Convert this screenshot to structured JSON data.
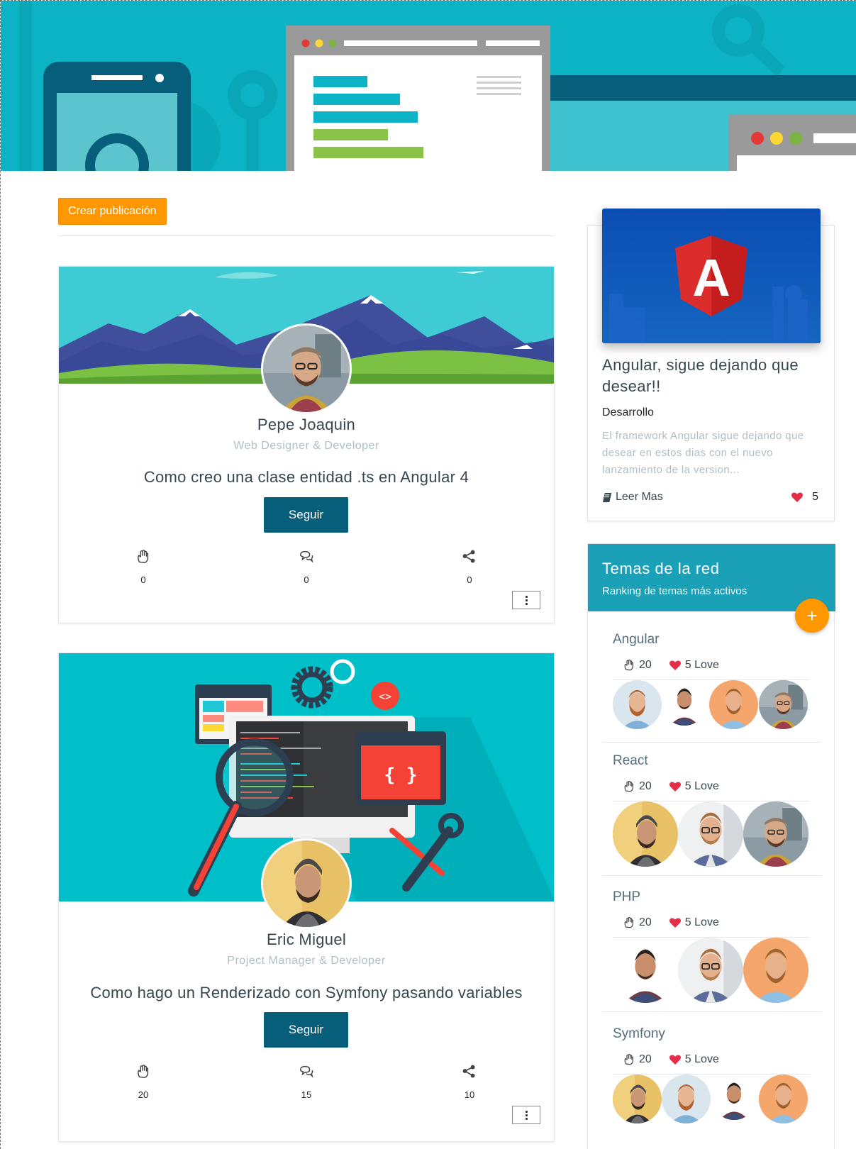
{
  "colors": {
    "hero_bg": "#0bb3c4",
    "accent_orange": "#ff9800",
    "follow_button": "#075e7a",
    "topics_header": "#1aa1b8",
    "heart": "#e52d4a"
  },
  "left": {
    "create_label": "Crear publicación"
  },
  "posts": [
    {
      "name": "Pepe Joaquin",
      "role": "Web Designer & Developer",
      "title": "Como creo una clase entidad .ts en Angular 4",
      "follow_label": "Seguir",
      "likes": "0",
      "comments": "0",
      "shares": "0"
    },
    {
      "name": "Eric Miguel",
      "role": "Project Manager & Developer",
      "title": "Como hago un Renderizado con Symfony pasando variables",
      "follow_label": "Seguir",
      "likes": "20",
      "comments": "15",
      "shares": "10"
    }
  ],
  "blog": {
    "title": "Angular, sigue dejando que desear!!",
    "category": "Desarrollo",
    "excerpt": "El framework Angular sigue dejando que desear en estos dias con el nuevo lanzamiento de la version...",
    "read_more": "Leer Mas",
    "likes": "5",
    "logo_letter": "A"
  },
  "topics": {
    "title": "Temas de la red",
    "subtitle": "Ranking de temas más activos",
    "add_symbol": "+",
    "items": [
      {
        "name": "Angular",
        "count": "20",
        "love": "5 Love"
      },
      {
        "name": "React",
        "count": "20",
        "love": "5 Love"
      },
      {
        "name": "PHP",
        "count": "20",
        "love": "5 Love"
      },
      {
        "name": "Symfony",
        "count": "20",
        "love": "5 Love"
      }
    ]
  }
}
